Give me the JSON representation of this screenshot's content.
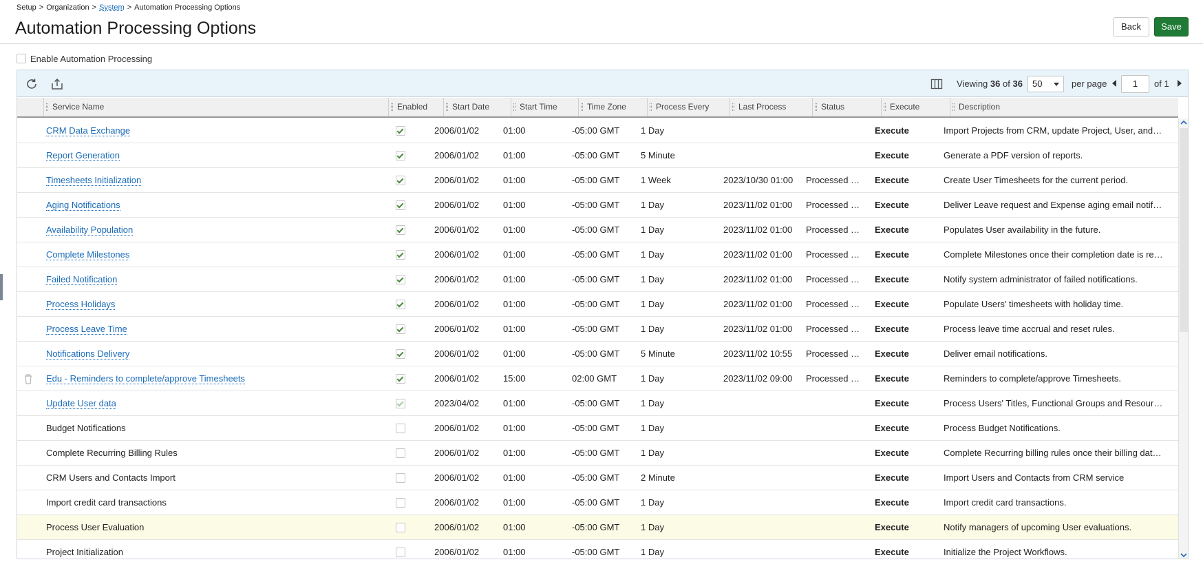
{
  "breadcrumb": {
    "item1": "Setup",
    "item2": "Organization",
    "item3": "System",
    "item4": "Automation Processing Options",
    "sep": ">"
  },
  "page": {
    "title": "Automation Processing Options"
  },
  "buttons": {
    "back": "Back",
    "save": "Save"
  },
  "enable_label": "Enable Automation Processing",
  "toolbar": {
    "viewing_label": "Viewing",
    "viewing_count": "36",
    "of_word": "of",
    "viewing_total": "36",
    "per_page_value": "50",
    "per_page_label": "per page",
    "page_value": "1",
    "of_pages": "of 1",
    "icons": {
      "refresh": "refresh-icon",
      "export": "export-icon",
      "columns": "columns-icon"
    }
  },
  "columns": [
    "Service Name",
    "Enabled",
    "Start Date",
    "Start Time",
    "Time Zone",
    "Process Every",
    "Last Process",
    "Status",
    "Execute",
    "Description"
  ],
  "rows": [
    {
      "name": "CRM Data Exchange",
      "link": true,
      "enabled": true,
      "start_date": "2006/01/02",
      "start_time": "01:00",
      "tz": "-05:00 GMT",
      "every": "1 Day",
      "last": "",
      "status": "",
      "execute": "Execute",
      "desc": "Import Projects from CRM, update Project, User, and C..."
    },
    {
      "name": "Report Generation",
      "link": true,
      "enabled": true,
      "start_date": "2006/01/02",
      "start_time": "01:00",
      "tz": "-05:00 GMT",
      "every": "5 Minute",
      "last": "",
      "status": "",
      "execute": "Execute",
      "desc": "Generate a PDF version of reports."
    },
    {
      "name": "Timesheets Initialization",
      "link": true,
      "enabled": true,
      "start_date": "2006/01/02",
      "start_time": "01:00",
      "tz": "-05:00 GMT",
      "every": "1 Week",
      "last": "2023/10/30 01:00",
      "status": "Processed s...",
      "execute": "Execute",
      "desc": "Create User Timesheets for the current period."
    },
    {
      "name": "Aging Notifications",
      "link": true,
      "enabled": true,
      "start_date": "2006/01/02",
      "start_time": "01:00",
      "tz": "-05:00 GMT",
      "every": "1 Day",
      "last": "2023/11/02 01:00",
      "status": "Processed s...",
      "execute": "Execute",
      "desc": "Deliver Leave request and Expense aging email notifica..."
    },
    {
      "name": "Availability Population",
      "link": true,
      "enabled": true,
      "start_date": "2006/01/02",
      "start_time": "01:00",
      "tz": "-05:00 GMT",
      "every": "1 Day",
      "last": "2023/11/02 01:00",
      "status": "Processed s...",
      "execute": "Execute",
      "desc": "Populates User availability in the future."
    },
    {
      "name": "Complete Milestones",
      "link": true,
      "enabled": true,
      "start_date": "2006/01/02",
      "start_time": "01:00",
      "tz": "-05:00 GMT",
      "every": "1 Day",
      "last": "2023/11/02 01:00",
      "status": "Processed s...",
      "execute": "Execute",
      "desc": "Complete Milestones once their completion date is rea..."
    },
    {
      "name": "Failed Notification",
      "link": true,
      "enabled": true,
      "start_date": "2006/01/02",
      "start_time": "01:00",
      "tz": "-05:00 GMT",
      "every": "1 Day",
      "last": "2023/11/02 01:00",
      "status": "Processed s...",
      "execute": "Execute",
      "desc": "Notify system administrator of failed notifications."
    },
    {
      "name": "Process Holidays",
      "link": true,
      "enabled": true,
      "start_date": "2006/01/02",
      "start_time": "01:00",
      "tz": "-05:00 GMT",
      "every": "1 Day",
      "last": "2023/11/02 01:00",
      "status": "Processed s...",
      "execute": "Execute",
      "desc": "Populate Users' timesheets with holiday time."
    },
    {
      "name": "Process Leave Time",
      "link": true,
      "enabled": true,
      "start_date": "2006/01/02",
      "start_time": "01:00",
      "tz": "-05:00 GMT",
      "every": "1 Day",
      "last": "2023/11/02 01:00",
      "status": "Processed s...",
      "execute": "Execute",
      "desc": "Process leave time accrual and reset rules."
    },
    {
      "name": "Notifications Delivery",
      "link": true,
      "enabled": true,
      "start_date": "2006/01/02",
      "start_time": "01:00",
      "tz": "-05:00 GMT",
      "every": "5 Minute",
      "last": "2023/11/02 10:55",
      "status": "Processed s...",
      "execute": "Execute",
      "desc": "Deliver email notifications."
    },
    {
      "name": "Edu - Reminders to complete/approve Timesheets",
      "link": true,
      "enabled": true,
      "trash": true,
      "start_date": "2006/01/02",
      "start_time": "15:00",
      "tz": "02:00 GMT",
      "every": "1 Day",
      "last": "2023/11/02 09:00",
      "status": "Processed s...",
      "execute": "Execute",
      "desc": "Reminders to complete/approve Timesheets."
    },
    {
      "name": "Update User data",
      "link": true,
      "enabled": true,
      "light": true,
      "start_date": "2023/04/02",
      "start_time": "01:00",
      "tz": "-05:00 GMT",
      "every": "1 Day",
      "last": "",
      "status": "",
      "execute": "Execute",
      "desc": "Process Users' Titles, Functional Groups and Resource ..."
    },
    {
      "name": "Budget Notifications",
      "link": false,
      "enabled": false,
      "start_date": "2006/01/02",
      "start_time": "01:00",
      "tz": "-05:00 GMT",
      "every": "1 Day",
      "last": "",
      "status": "",
      "execute": "Execute",
      "desc": "Process Budget Notifications."
    },
    {
      "name": "Complete Recurring Billing Rules",
      "link": false,
      "enabled": false,
      "start_date": "2006/01/02",
      "start_time": "01:00",
      "tz": "-05:00 GMT",
      "every": "1 Day",
      "last": "",
      "status": "",
      "execute": "Execute",
      "desc": "Complete Recurring billing rules once their billing date i..."
    },
    {
      "name": "CRM Users and Contacts Import",
      "link": false,
      "enabled": false,
      "start_date": "2006/01/02",
      "start_time": "01:00",
      "tz": "-05:00 GMT",
      "every": "2 Minute",
      "last": "",
      "status": "",
      "execute": "Execute",
      "desc": "Import Users and Contacts from CRM service"
    },
    {
      "name": "Import credit card transactions",
      "link": false,
      "enabled": false,
      "start_date": "2006/01/02",
      "start_time": "01:00",
      "tz": "-05:00 GMT",
      "every": "1 Day",
      "last": "",
      "status": "",
      "execute": "Execute",
      "desc": "Import credit card transactions."
    },
    {
      "name": "Process User Evaluation",
      "link": false,
      "enabled": false,
      "highlight": true,
      "start_date": "2006/01/02",
      "start_time": "01:00",
      "tz": "-05:00 GMT",
      "every": "1 Day",
      "last": "",
      "status": "",
      "execute": "Execute",
      "desc": "Notify managers of upcoming User evaluations."
    },
    {
      "name": "Project Initialization",
      "link": false,
      "enabled": false,
      "start_date": "2006/01/02",
      "start_time": "01:00",
      "tz": "-05:00 GMT",
      "every": "1 Day",
      "last": "",
      "status": "",
      "execute": "Execute",
      "desc": "Initialize the Project Workflows."
    }
  ],
  "colors": {
    "accent": "#1a6bb8",
    "save_button": "#1e7a34",
    "toolbar_bg": "#e8f3fa",
    "check": "#4a8a3b",
    "highlight_row": "#fbfbe6"
  }
}
